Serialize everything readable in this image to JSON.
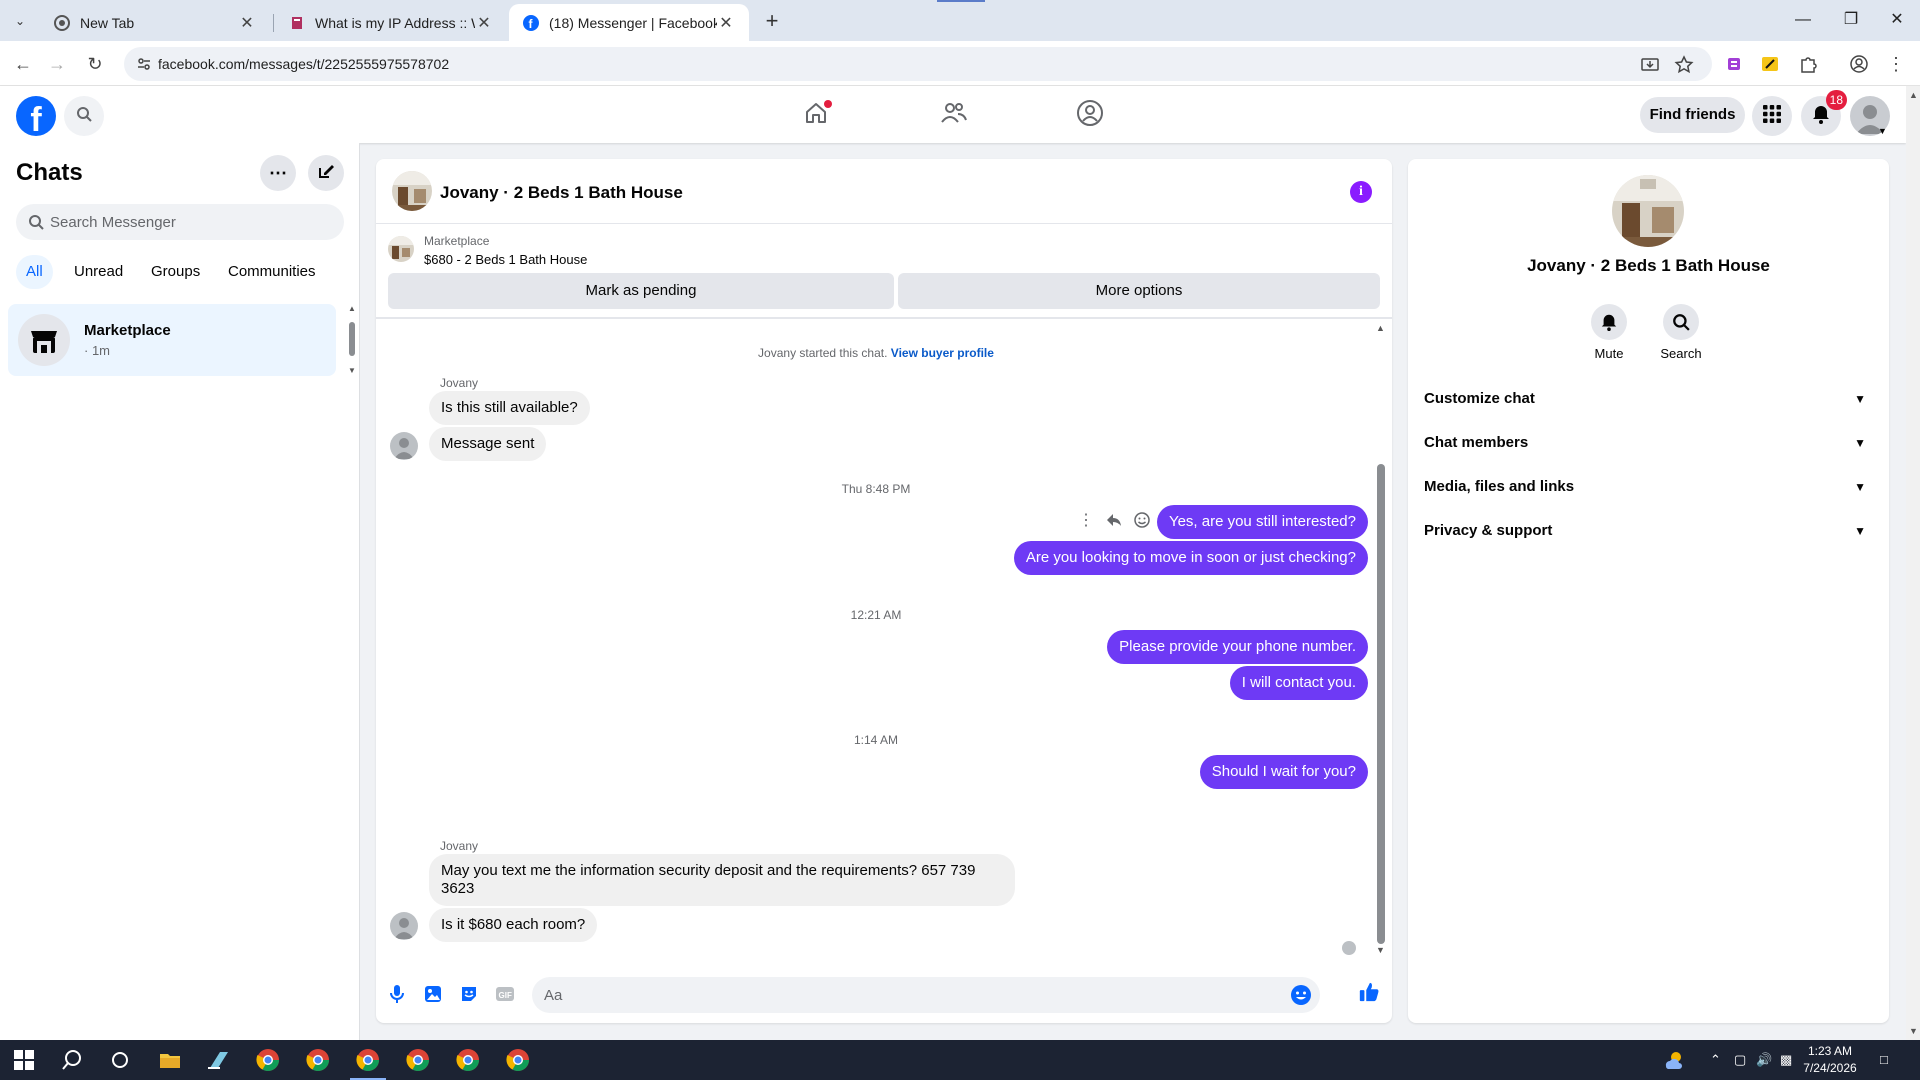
{
  "browser": {
    "tabs": [
      {
        "title": "New Tab",
        "icon": "chrome-icon"
      },
      {
        "title": "What is my IP Address :: WebBr",
        "icon": "webbrowser-icon"
      },
      {
        "title": "(18) Messenger | Facebook",
        "icon": "facebook-icon",
        "active": true
      }
    ],
    "url": "facebook.com/messages/t/2252555975578702"
  },
  "fb_header": {
    "find_friends": "Find friends",
    "notifications_count": "18"
  },
  "sidebar": {
    "title": "Chats",
    "search_placeholder": "Search Messenger",
    "filters": [
      "All",
      "Unread",
      "Groups",
      "Communities"
    ],
    "conversations": [
      {
        "name": "Marketplace",
        "meta": "· 1m"
      }
    ]
  },
  "conversation": {
    "title": "Jovany · 2 Beds 1 Bath House",
    "marketplace": {
      "source": "Marketplace",
      "listing": "$680 - 2 Beds 1 Bath House",
      "mark_pending": "Mark as pending",
      "more_options": "More options"
    },
    "system_text": "Jovany started this chat.",
    "system_link": "View buyer profile",
    "messages": {
      "sender1": "Jovany",
      "in1": "Is this still available?",
      "in2": "Message sent",
      "time1": "Thu 8:48 PM",
      "out1": "Yes, are you still interested?",
      "out2": "Are you looking to move in soon or just checking?",
      "time2": "12:21 AM",
      "out3": "Please provide your phone number.",
      "out4": "I will contact you.",
      "time3": "1:14 AM",
      "out5": "Should I wait for you?",
      "sender2": "Jovany",
      "in3_line1": "May you text me the information security deposit and the requirements? 657 739",
      "in3_line2": "3623",
      "in4": "Is it $680 each room?"
    },
    "composer_placeholder": "Aa"
  },
  "info_panel": {
    "name": "Jovany · 2 Beds 1 Bath House",
    "actions": [
      "Mute",
      "Search"
    ],
    "sections": [
      "Customize chat",
      "Chat members",
      "Media, files and links",
      "Privacy & support"
    ]
  },
  "taskbar": {
    "time": "1:23 AM",
    "date": "7/24/2026"
  },
  "colors": {
    "fb_blue": "#0866ff",
    "outgoing_bubble": "#6e3af5",
    "incoming_bubble": "#f0f0f0",
    "badge_red": "#e41e3f"
  }
}
